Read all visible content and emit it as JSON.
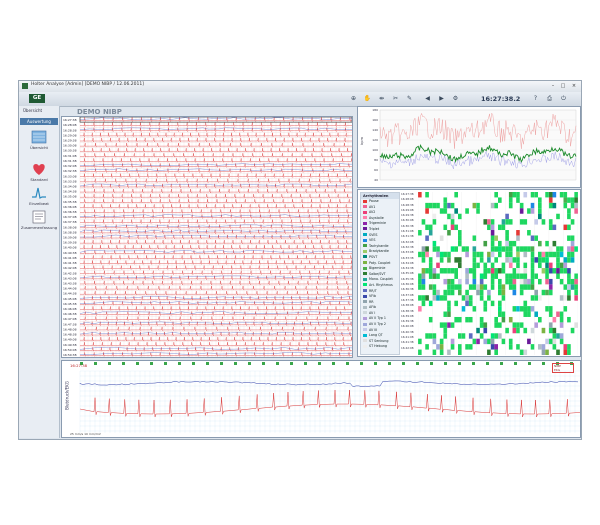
{
  "window": {
    "title": "Holter Analyse [Admin] [DEMO NIBP / 12.06.2011]",
    "demo_label": "DEMO NIBP",
    "clock": "16:27:38.2"
  },
  "sidebar": {
    "header": "Auswertung",
    "items": [
      {
        "label": "Übersicht",
        "icon": "overview-icon"
      },
      {
        "label": "Standard",
        "icon": "heart-icon"
      },
      {
        "label": "Einzelbeat",
        "icon": "beat-icon"
      },
      {
        "label": "Zusammenfassung",
        "icon": "summary-icon"
      }
    ],
    "top_label": "Übersicht"
  },
  "ecg_times": [
    "16:27:38",
    "16:28:08",
    "16:28:38",
    "16:29:08",
    "16:29:38",
    "16:30:08",
    "16:30:38",
    "16:31:08",
    "16:31:38",
    "16:32:08",
    "16:32:38",
    "16:33:08",
    "16:33:38",
    "16:34:08",
    "16:34:38",
    "16:35:08",
    "16:35:38",
    "16:36:08",
    "16:36:38",
    "16:37:08",
    "16:37:38",
    "16:38:08",
    "16:38:38",
    "16:39:08",
    "16:39:38",
    "16:40:08",
    "16:40:38",
    "16:41:08",
    "16:41:38",
    "16:42:08",
    "16:42:38",
    "16:43:08",
    "16:43:38",
    "16:44:08",
    "16:44:38",
    "16:45:08",
    "16:45:38",
    "16:46:08",
    "16:46:38",
    "16:47:08",
    "16:47:38",
    "16:48:08",
    "16:48:38",
    "16:49:08",
    "16:49:38",
    "16:50:08",
    "16:50:38"
  ],
  "trend": {
    "ylabel": "bpm",
    "ticks": [
      "180",
      "160",
      "140",
      "120",
      "100",
      "80",
      "60",
      "40"
    ],
    "colors": {
      "upper": "#e88080",
      "mean": "#1a8a2a",
      "lower": "#8080e0"
    }
  },
  "arrhythmia": {
    "header": "Arrhythmien",
    "items": [
      {
        "label": "Pause",
        "color": "#e53935"
      },
      {
        "label": "AV1",
        "color": "#f06292"
      },
      {
        "label": "AV2",
        "color": "#ec407a"
      },
      {
        "label": "Asystolie",
        "color": "#ff80ab"
      },
      {
        "label": "Trigeminie",
        "color": "#8e24aa"
      },
      {
        "label": "Triplet",
        "color": "#6a1b9a"
      },
      {
        "label": "SVES",
        "color": "#00acc1"
      },
      {
        "label": "VES",
        "color": "#1e88e5"
      },
      {
        "label": "Tachykardie",
        "color": "#43a047"
      },
      {
        "label": "Bradykardie",
        "color": "#9ccc65"
      },
      {
        "label": "PSVT",
        "color": "#00897b"
      },
      {
        "label": "Paty. Couplet",
        "color": "#7cb342"
      },
      {
        "label": "Bigeminie",
        "color": "#4caf50"
      },
      {
        "label": "Salbe/SVT",
        "color": "#2e7d32"
      },
      {
        "label": "Mono. Couplet",
        "color": "#26a69a"
      },
      {
        "label": "Art. Rhythmus",
        "color": "#00e676"
      },
      {
        "label": "RR/T",
        "color": "#5c6bc0"
      },
      {
        "label": "VFib",
        "color": "#3949ab"
      },
      {
        "label": "RR",
        "color": "#90a4ae"
      },
      {
        "label": "AFib",
        "color": "#b0bec5"
      },
      {
        "label": "AV I",
        "color": "#cfd8dc"
      },
      {
        "label": "AV II Typ 1",
        "color": "#b39ddb"
      },
      {
        "label": "AV II Typ 2",
        "color": "#9fa8da"
      },
      {
        "label": "AV III",
        "color": "#c5cae9"
      },
      {
        "label": "Lang QT",
        "color": "#00bcd4"
      },
      {
        "label": "ST Senkung",
        "color": "#e0e0e0"
      },
      {
        "label": "ST Hebung",
        "color": "#eeeeee"
      }
    ],
    "times": [
      "16:27:38",
      "16:28:08",
      "16:28:38",
      "16:29:08",
      "16:29:38",
      "16:30:08",
      "16:30:38",
      "16:31:08",
      "16:31:38",
      "16:32:08",
      "16:32:38",
      "16:33:08",
      "16:33:38",
      "16:34:08",
      "16:34:38",
      "16:35:08",
      "16:35:38",
      "16:36:08",
      "16:36:38",
      "16:37:08",
      "16:37:38",
      "16:38:08",
      "16:38:38",
      "16:39:08",
      "16:39:38",
      "16:40:08",
      "16:40:38",
      "16:41:08",
      "16:41:38",
      "16:42:08"
    ]
  },
  "bottom": {
    "label": "Blutdruck/EKG",
    "time": "16:27:38",
    "legend": [
      "NIBP",
      "EKG"
    ],
    "footer": "25 mm/s  10 mm/mV"
  },
  "colors": {
    "ecg_line": "#d62020",
    "ecg_dark": "#222222",
    "grid": "#f4c9c9",
    "accent": "#4a79a8"
  }
}
